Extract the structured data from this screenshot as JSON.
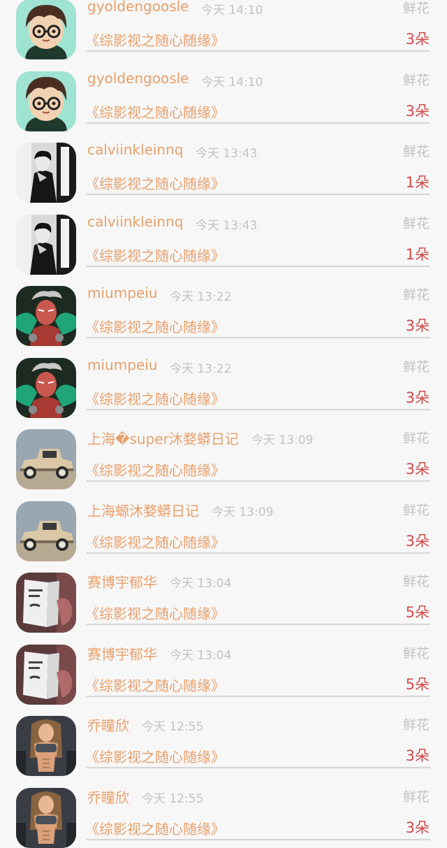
{
  "items": [
    {
      "name": "gyoldengoosle",
      "time": "今天 14:10",
      "type": "鲜花",
      "title": "《综影视之随心随缘》",
      "count": "3朵",
      "avatar": "cartoon-boy"
    },
    {
      "name": "gyoldengoosle",
      "time": "今天 14:10",
      "type": "鲜花",
      "title": "《综影视之随心随缘》",
      "count": "3朵",
      "avatar": "cartoon-boy"
    },
    {
      "name": "calviinkleinnq",
      "time": "今天 13:43",
      "type": "鲜花",
      "title": "《综影视之随心随缘》",
      "count": "1朵",
      "avatar": "bw-portrait"
    },
    {
      "name": "calviinkleinnq",
      "time": "今天 13:43",
      "type": "鲜花",
      "title": "《综影视之随心随缘》",
      "count": "1朵",
      "avatar": "bw-portrait"
    },
    {
      "name": "miumpeiu",
      "time": "今天 13:22",
      "type": "鲜花",
      "title": "《综影视之随心随缘》",
      "count": "3朵",
      "avatar": "game-character"
    },
    {
      "name": "miumpeiu",
      "time": "今天 13:22",
      "type": "鲜花",
      "title": "《综影视之随心随缘》",
      "count": "3朵",
      "avatar": "game-character"
    },
    {
      "name": "上海�super沐婺蟒日记",
      "time": "今天 13:09",
      "type": "鲜花",
      "title": "《综影视之随心随缘》",
      "count": "3朵",
      "avatar": "vintage-car"
    },
    {
      "name": "上海螈沐婺蟒日记",
      "time": "今天 13:09",
      "type": "鲜花",
      "title": "《综影视之随心随缘》",
      "count": "3朵",
      "avatar": "vintage-car"
    },
    {
      "name": "赛博宇郁华",
      "time": "今天 13:04",
      "type": "鲜花",
      "title": "《综影视之随心随缘》",
      "count": "5朵",
      "avatar": "book-reader"
    },
    {
      "name": "赛博宇郁华",
      "time": "今天 13:04",
      "type": "鲜花",
      "title": "《综影视之随心随缘》",
      "count": "5朵",
      "avatar": "book-reader"
    },
    {
      "name": "乔瞳欣",
      "time": "今天 12:55",
      "type": "鲜花",
      "title": "《综影视之随心随缘》",
      "count": "3朵",
      "avatar": "fitness-woman"
    },
    {
      "name": "乔瞳欣",
      "time": "今天 12:55",
      "type": "鲜花",
      "title": "《综影视之随心随缘》",
      "count": "3朵",
      "avatar": "fitness-woman"
    }
  ]
}
